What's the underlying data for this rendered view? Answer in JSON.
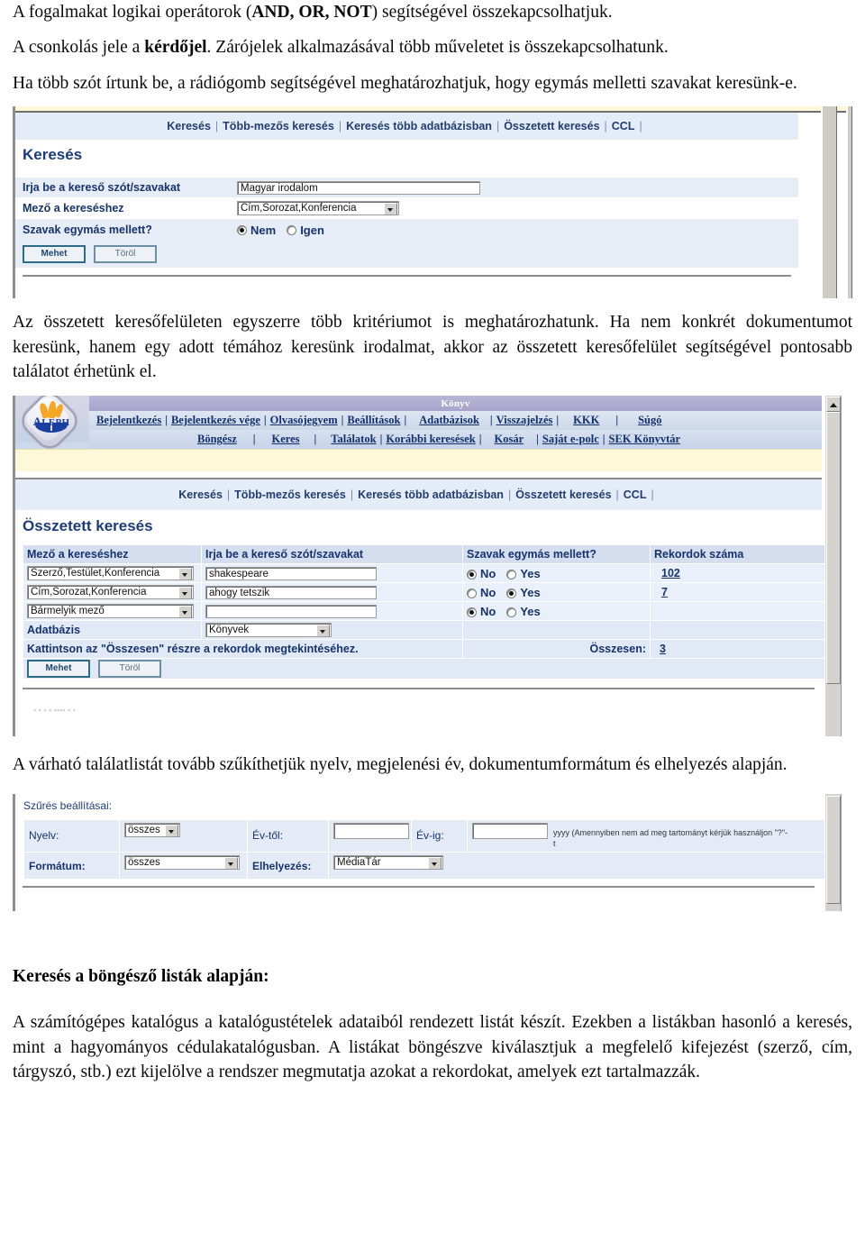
{
  "document": {
    "paragraphs": {
      "p1_pre": "A fogalmakat logikai operátorok (",
      "p1_bold": "AND, OR, NOT",
      "p1_post": ") segítségével összekapcsolhatjuk.",
      "p2_pre": "A csonkolás jele a ",
      "p2_bold": "kérdőjel",
      "p2_post": ". Zárójelek alkalmazásával több műveletet is összekapcsolhatunk.",
      "p3": "Ha több szót írtunk be, a rádiógomb segítségével meghatározhatjuk, hogy egymás melletti szavakat keresünk-e.",
      "p4": "Az összetett keresőfelületen egyszerre több kritériumot is meghatározhatunk. Ha nem konkrét dokumentumot keresünk, hanem egy adott témához keresünk irodalmat, akkor az összetett keresőfelület segítségével pontosabb találatot érhetünk el.",
      "p5": "A várható találatlistát tovább szűkíthetjük nyelv, megjelenési év, dokumentumformátum és elhelyezés alapján.",
      "h1": "Keresés a böngésző listák alapján:",
      "p6": "A számítógépes katalógus a katalógustételek adataiból rendezett listát készít. Ezekben a listákban hasonló a keresés, mint a hagyományos cédulakatalógusban. A listákat böngészve kiválasztjuk a megfelelő kifejezést (szerző, cím, tárgyszó, stb.) ezt kijelölve a rendszer megmutatja azokat a rekordokat, amelyek ezt tartalmazzák."
    }
  },
  "screenshot_simple_search": {
    "tabs": [
      "Keresés",
      "Több-mezős keresés",
      "Keresés több adatbázisban",
      "Összetett keresés",
      "CCL"
    ],
    "page_title": "Keresés",
    "fields": {
      "query_label": "Irja be a kereső szót/szavakat",
      "query_value": "Magyar irodalom",
      "field_label": "Mező a kereséshez",
      "field_value": "Cím,Sorozat,Konferencia",
      "adjacency_label": "Szavak egymás mellett?",
      "adjacency_no": "Nem",
      "adjacency_yes": "Igen",
      "adjacency_selected": "Nem"
    },
    "buttons": {
      "submit": "Mehet",
      "clear": "Töröl"
    }
  },
  "screenshot_advanced_search": {
    "window_title": "Könyv",
    "nav_row1": [
      "Bejelentkezés",
      "Bejelentkezés vége",
      "Olvasójegyem",
      "Beállítások",
      "Adatbázisok",
      "Visszajelzés",
      "KKK",
      "Súgó"
    ],
    "nav_row2": [
      "Böngész",
      "Keres",
      "Találatok",
      "Korábbi keresések",
      "Kosár",
      "Saját e-polc",
      "SEK Könyvtár"
    ],
    "tabs": [
      "Keresés",
      "Több-mezős keresés",
      "Keresés több adatbázisban",
      "Összetett keresés",
      "CCL"
    ],
    "page_title": "Összetett keresés",
    "table": {
      "headers": [
        "Mező a kereséshez",
        "Irja be a kereső szót/szavakat",
        "Szavak egymás mellett?",
        "Rekordok száma"
      ],
      "rows": [
        {
          "field": "Szerző,Testület,Konferencia",
          "term": "shakespeare",
          "adjacency": "No",
          "no_label": "No",
          "yes_label": "Yes",
          "count": "102"
        },
        {
          "field": "Cím,Sorozat,Konferencia",
          "term": "ahogy tetszik",
          "adjacency": "Yes",
          "no_label": "No",
          "yes_label": "Yes",
          "count": "7"
        },
        {
          "field": "Bármelyik mező",
          "term": "",
          "adjacency": "No",
          "no_label": "No",
          "yes_label": "Yes",
          "count": ""
        }
      ]
    },
    "database_label": "Adatbázis",
    "database_value": "Könyvek",
    "total_hint": "Kattintson az \"Összesen\" részre a rekordok megtekintéséhez.",
    "total_label": "Összesen:",
    "total_value": "3",
    "buttons": {
      "submit": "Mehet",
      "clear": "Töröl"
    }
  },
  "screenshot_filters": {
    "caption": "Szűrés beállításai:",
    "language_label": "Nyelv:",
    "language_value": "összes",
    "year_from_label": "Év-től:",
    "year_from_value": "",
    "year_to_label": "Év-ig:",
    "year_to_value": "",
    "year_hint": "yyyy (Amennyiben nem ad meg tartományt kérjük használjon \"?\"-",
    "year_hint_cont": "t",
    "format_label": "Formátum:",
    "format_value": "összes",
    "location_label": "Elhelyezés:",
    "location_value": "MédiaTár"
  },
  "colors": {
    "link": "#12306b",
    "heading": "#1b3b7a",
    "tab_bar_bg": "#e4ecf7",
    "table_header_bg": "#d5deef",
    "row_bg": "#eaf0f9",
    "yellow_bar": "#fcf8d8",
    "title_bar": "#a6a3cb",
    "button_border": "#2e6b86"
  }
}
